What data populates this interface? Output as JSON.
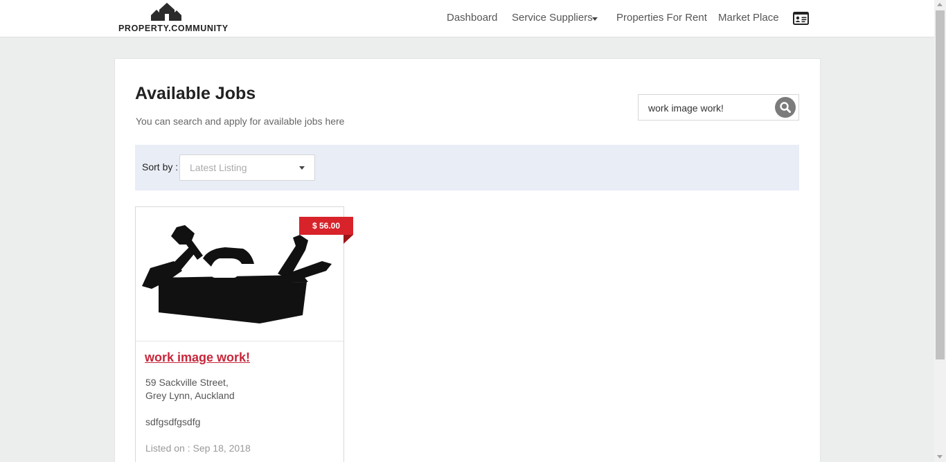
{
  "brand": {
    "logo_text": "PROPERTY.COMMUNITY"
  },
  "nav": {
    "items": [
      {
        "label": "Dashboard"
      },
      {
        "label": "Service Suppliers"
      },
      {
        "label": "Properties For Rent"
      },
      {
        "label": "Market Place"
      }
    ],
    "profile_icon": "id-card-icon"
  },
  "page": {
    "title": "Available Jobs",
    "subtitle": "You can search and apply for available jobs here"
  },
  "search": {
    "value": "work image work!",
    "icon": "search-icon"
  },
  "sort": {
    "label": "Sort by :",
    "selected": "Latest Listing"
  },
  "jobs": [
    {
      "price": "$ 56.00",
      "title": "work image work!",
      "address_line1": "59 Sackville Street,",
      "address_line2": "Grey Lynn, Auckland",
      "description": "sdfgsdfgsdfg",
      "listed_on": "Listed on : Sep 18, 2018",
      "image_icon": "toolbox-icon"
    }
  ],
  "colors": {
    "accent": "#c7263a",
    "price_tag": "#d8232a",
    "sort_bar": "#e9edf6",
    "background": "#eceded"
  }
}
